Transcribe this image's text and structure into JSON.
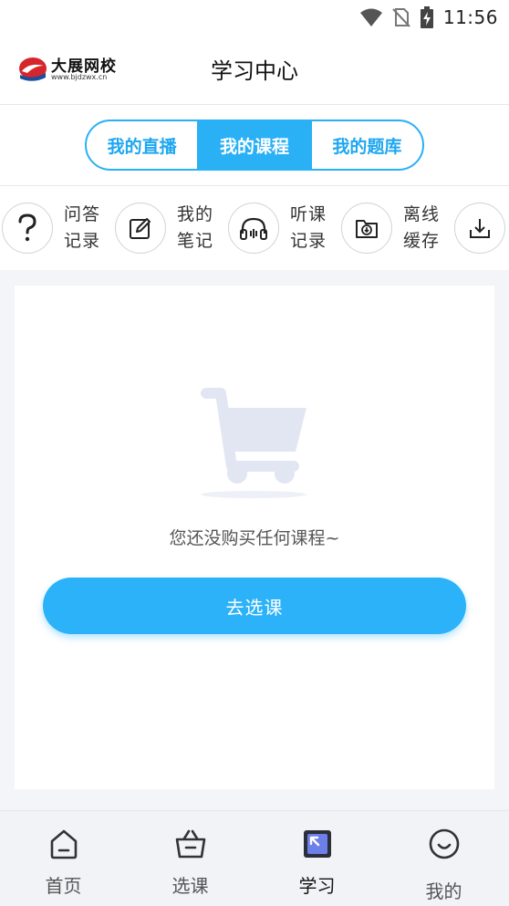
{
  "status_bar": {
    "time": "11:56"
  },
  "header": {
    "logo_name": "大展网校",
    "logo_url": "www.bjdzwx.cn",
    "title": "学习中心"
  },
  "segment_tabs": [
    {
      "label": "我的直播",
      "active": false
    },
    {
      "label": "我的课程",
      "active": true
    },
    {
      "label": "我的题库",
      "active": false
    }
  ],
  "quick_actions": [
    {
      "line1": "问答",
      "line2": "记录",
      "icon": "question-icon"
    },
    {
      "line1": "我的",
      "line2": "笔记",
      "icon": "edit-note-icon"
    },
    {
      "line1": "听课",
      "line2": "记录",
      "icon": "headphones-icon"
    },
    {
      "line1": "离线",
      "line2": "缓存",
      "icon": "folder-download-icon"
    },
    {
      "line1": "",
      "line2": "",
      "icon": "download-icon"
    }
  ],
  "empty_state": {
    "message": "您还没购买任何课程~",
    "button": "去选课",
    "icon": "shopping-cart-icon"
  },
  "bottom_nav": [
    {
      "label": "首页",
      "icon": "home-icon",
      "active": false
    },
    {
      "label": "选课",
      "icon": "basket-icon",
      "active": false
    },
    {
      "label": "学习",
      "icon": "study-icon",
      "active": true
    },
    {
      "label": "我的",
      "icon": "smile-icon",
      "active": false
    }
  ],
  "colors": {
    "accent": "#29b0f5",
    "background": "#f4f5f9",
    "cart_icon": "#e2e6f3"
  }
}
